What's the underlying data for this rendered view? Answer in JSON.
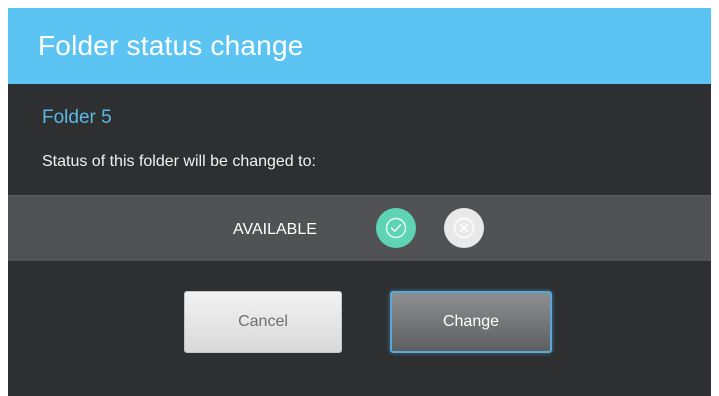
{
  "dialog": {
    "title": "Folder status change",
    "folder_name": "Folder 5",
    "message": "Status of this folder will be changed to:",
    "status": {
      "label": "AVAILABLE",
      "available_icon": "check-circle-icon",
      "unavailable_icon": "x-circle-icon",
      "selected": "available",
      "available_color": "#5fd3b6",
      "unavailable_color": "#e9e9e9"
    },
    "buttons": {
      "cancel_label": "Cancel",
      "change_label": "Change"
    },
    "colors": {
      "header": "#5bc4f2",
      "body": "#2d2f31",
      "folder_name": "#5bb8e6",
      "status_bar": "#505254",
      "focus_border": "#5aa6d8"
    }
  }
}
